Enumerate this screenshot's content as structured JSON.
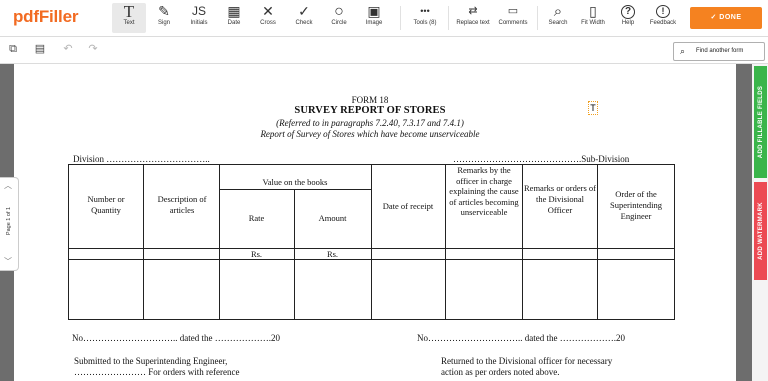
{
  "app": {
    "logo": "pdfFiller"
  },
  "toolbar": {
    "tools": [
      {
        "name": "text",
        "label": "Text",
        "glyph": "T",
        "icon": "text-icon"
      },
      {
        "name": "sign",
        "label": "Sign",
        "glyph": "✎",
        "icon": "signature-icon"
      },
      {
        "name": "initials",
        "label": "Initials",
        "glyph": "JS",
        "icon": "initials-icon"
      },
      {
        "name": "date",
        "label": "Date",
        "glyph": "▦",
        "icon": "calendar-icon"
      },
      {
        "name": "cross",
        "label": "Cross",
        "glyph": "✕",
        "icon": "cross-icon"
      },
      {
        "name": "check",
        "label": "Check",
        "glyph": "✓",
        "icon": "check-icon"
      },
      {
        "name": "circle",
        "label": "Circle",
        "glyph": "○",
        "icon": "circle-icon"
      },
      {
        "name": "image",
        "label": "Image",
        "glyph": "▣",
        "icon": "image-icon"
      },
      {
        "name": "tools",
        "label": "Tools (8)",
        "glyph": "•••",
        "icon": "more-icon"
      },
      {
        "name": "replace",
        "label": "Replace text",
        "glyph": "⇄",
        "icon": "replace-text-icon"
      },
      {
        "name": "comments",
        "label": "Comments",
        "glyph": "▭",
        "icon": "comment-icon"
      },
      {
        "name": "search",
        "label": "Search",
        "glyph": "⌕",
        "icon": "search-icon"
      },
      {
        "name": "fitwidth",
        "label": "Fit Width",
        "glyph": "▯",
        "icon": "fit-width-icon"
      },
      {
        "name": "help",
        "label": "Help",
        "glyph": "?",
        "icon": "help-icon"
      },
      {
        "name": "feedback",
        "label": "Feedback",
        "glyph": "!",
        "icon": "feedback-icon"
      }
    ],
    "done_label": "DONE",
    "done_glyph": "✓"
  },
  "subbar": {
    "find_form_label": "Find another form"
  },
  "page_nav": {
    "label": "Page 1 of 1"
  },
  "side_tabs": {
    "fillable": {
      "label": "ADD FILLABLE FIELDS",
      "color": "#3ab54a"
    },
    "watermark": {
      "label": "ADD WATERMARK",
      "color": "#ec4a53"
    }
  },
  "document": {
    "form_no": "FORM 18",
    "title": "SURVEY REPORT OF STORES",
    "ref": "(Referred to in paragraphs 7.2.40, 7.3.17 and 7.4.1)",
    "subtitle": "Report of Survey of Stores which have become unserviceable",
    "division_label": "Division ……………………………..",
    "subdivision_label": "…………………………………….Sub-Division",
    "headers": {
      "number": "Number or Quantity",
      "description": "Description of articles",
      "value_books": "Value on the books",
      "rate": "Rate",
      "amount": "Amount",
      "date_receipt": "Date of receipt",
      "remarks_officer": "Remarks by the officer in charge explaining the cause of articles becoming unserviceable",
      "remarks_divisional": "Remarks or orders of the Divisional Officer",
      "order_engineer": "Order of the Superintending Engineer"
    },
    "currency_rate": "Rs.",
    "currency_amount": "Rs.",
    "no_left": "No………………………….. dated the ……………….20",
    "no_right": "No………………………….. dated the ……………….20",
    "submitted_1": "Submitted to the Superintending Engineer,",
    "submitted_2": "…………………… For orders with reference",
    "returned_1": "Returned to the Divisional officer for necessary",
    "returned_2": "action as per orders noted above.",
    "text_marker": "T"
  }
}
